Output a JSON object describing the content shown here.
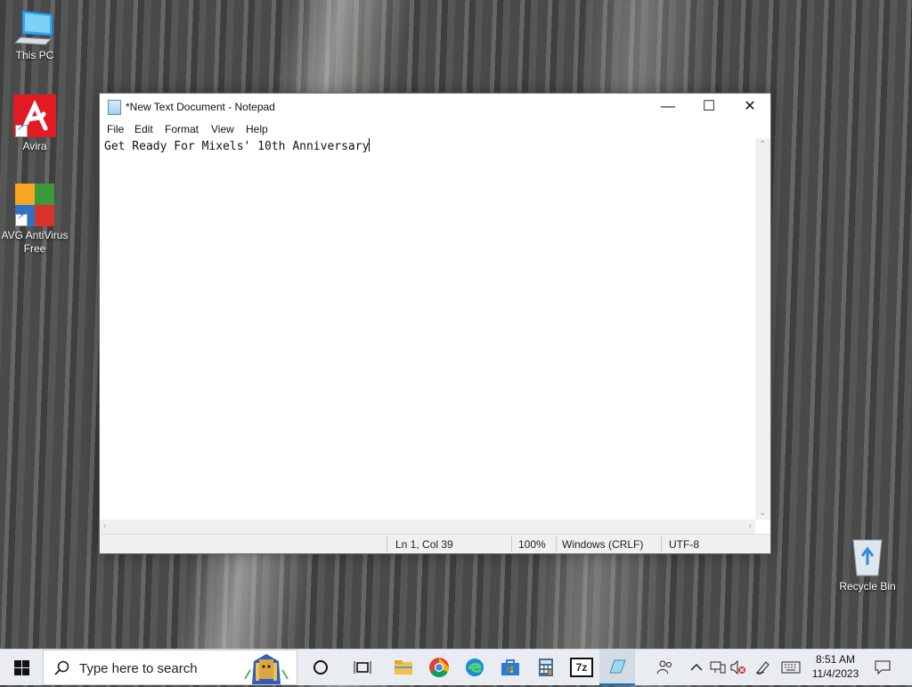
{
  "desktop": {
    "icons": [
      {
        "label": "This PC",
        "icon": "computer-icon"
      },
      {
        "label": "Avira",
        "icon": "avira-icon"
      },
      {
        "label": "AVG AntiVirus Free",
        "icon": "avg-icon"
      },
      {
        "label": "Recycle Bin",
        "icon": "recycle-bin-icon"
      }
    ]
  },
  "window": {
    "title": "*New Text Document - Notepad",
    "controls": {
      "minimize": "—",
      "maximize": "☐",
      "close": "✕"
    },
    "menu": [
      "File",
      "Edit",
      "Format",
      "View",
      "Help"
    ],
    "content": "Get Ready For Mixels' 10th Anniversary",
    "status": {
      "position": "Ln 1, Col 39",
      "zoom": "100%",
      "line_ending": "Windows (CRLF)",
      "encoding": "UTF-8"
    }
  },
  "taskbar": {
    "search_placeholder": "Type here to search",
    "pinned": [
      "task-view",
      "file-explorer",
      "chrome",
      "edge",
      "store",
      "calculator",
      "7-zip",
      "notepad"
    ],
    "tray": {
      "time": "8:51 AM",
      "date": "11/4/2023"
    }
  },
  "colors": {
    "accent": "#0078d7",
    "taskbar": "#e9edf2",
    "window_bg": "#ffffff"
  }
}
